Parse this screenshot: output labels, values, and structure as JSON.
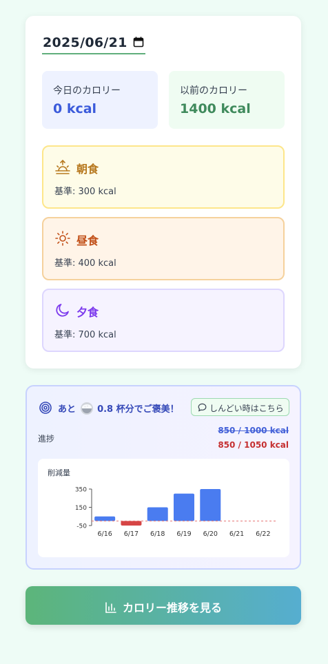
{
  "date": {
    "value": "2025/06/21",
    "icon": "calendar-icon"
  },
  "stats": {
    "today": {
      "label": "今日のカロリー",
      "value": "0 kcal"
    },
    "previous": {
      "label": "以前のカロリー",
      "value": "1400 kcal"
    }
  },
  "meals": [
    {
      "name": "朝食",
      "base": "基準: 300 kcal",
      "icon": "sunrise-icon",
      "color": "#b7791f"
    },
    {
      "name": "昼食",
      "base": "基準: 400 kcal",
      "icon": "sun-icon",
      "color": "#c2511a"
    },
    {
      "name": "夕食",
      "base": "基準: 700 kcal",
      "icon": "moon-icon",
      "color": "#7c3aed"
    }
  ],
  "progress": {
    "reward_prefix": "あと",
    "reward_suffix": "0.8 杯分でご褒美！",
    "help_label": "しんどい時はこちら",
    "label": "進捗",
    "old_value": "850 / 1000 kcal",
    "new_value": "850 / 1050 kcal"
  },
  "chart_data": {
    "type": "bar",
    "title": "削減量",
    "categories": [
      "6/16",
      "6/17",
      "6/18",
      "6/19",
      "6/20",
      "6/21",
      "6/22"
    ],
    "values": [
      50,
      -50,
      150,
      300,
      350,
      null,
      null
    ],
    "y_ticks": [
      "350",
      "150",
      "-50"
    ],
    "ylim": [
      -50,
      350
    ],
    "reference_line": 0,
    "colors": {
      "positive": "#4a7cf0",
      "negative": "#d64545",
      "reference": "#e57373"
    }
  },
  "cta": {
    "label": "カロリー推移を見る",
    "icon": "bar-chart-icon"
  }
}
